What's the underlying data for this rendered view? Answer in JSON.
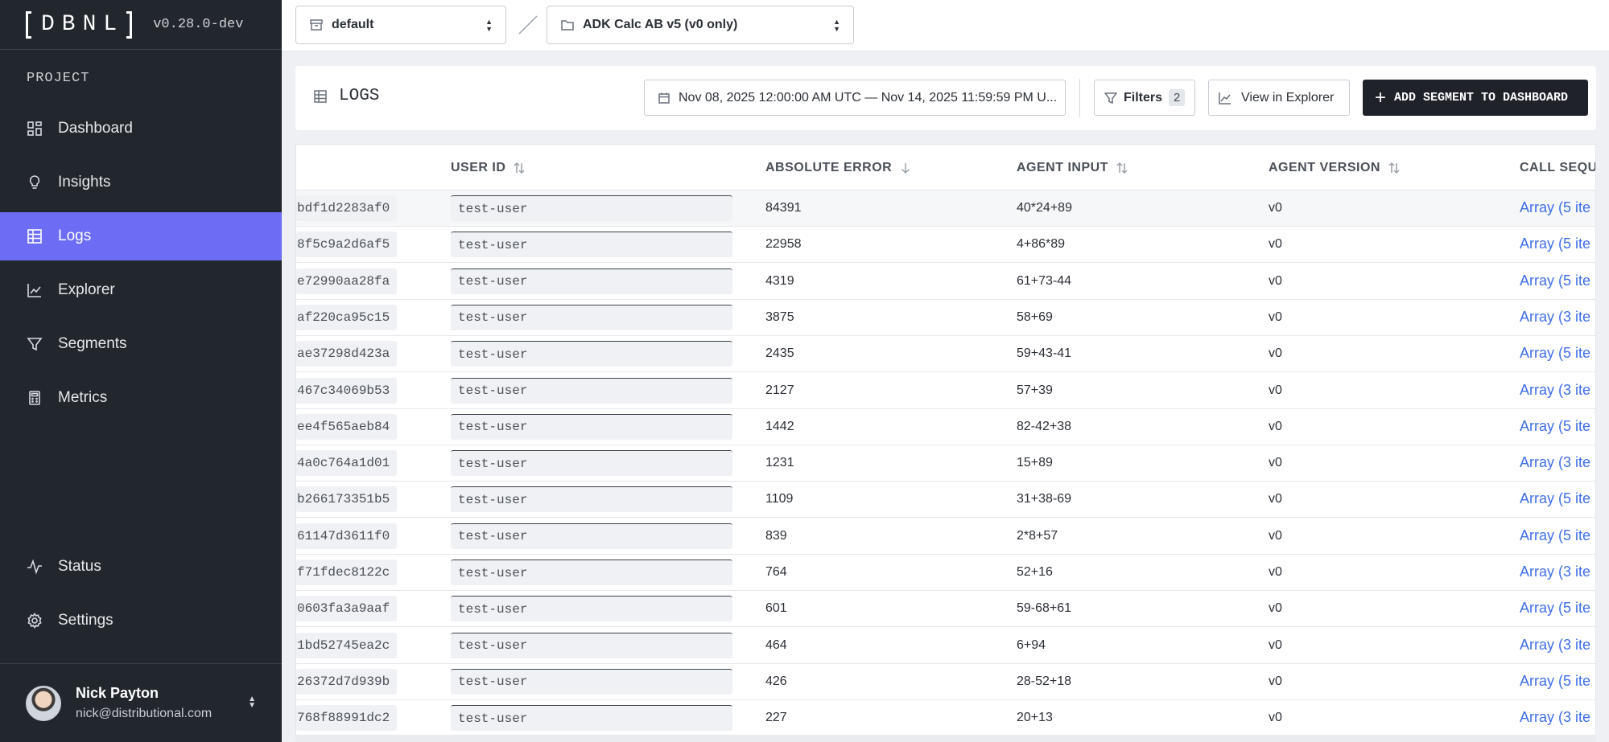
{
  "sidebar": {
    "logo_text": "DBNL",
    "version": "v0.28.0-dev",
    "section_title": "PROJECT",
    "items": [
      {
        "label": "Dashboard",
        "icon": "dashboard-icon"
      },
      {
        "label": "Insights",
        "icon": "lightbulb-icon"
      },
      {
        "label": "Logs",
        "icon": "table-icon",
        "active": true
      },
      {
        "label": "Explorer",
        "icon": "line-chart-icon"
      },
      {
        "label": "Segments",
        "icon": "filter-icon"
      },
      {
        "label": "Metrics",
        "icon": "calculator-icon"
      }
    ],
    "bottom_items": [
      {
        "label": "Status",
        "icon": "pulse-icon"
      },
      {
        "label": "Settings",
        "icon": "gear-icon"
      }
    ],
    "user": {
      "name": "Nick Payton",
      "email": "nick@distributional.com"
    }
  },
  "topbar": {
    "namespace": "default",
    "project": "ADK Calc AB v5 (v0 only)"
  },
  "header": {
    "title": "LOGS",
    "date_range": "Nov 08, 2025 12:00:00 AM UTC — Nov 14, 2025 11:59:59 PM U...",
    "filters_label": "Filters",
    "filters_count": "2",
    "explorer_label": "View in Explorer",
    "add_segment_label": "ADD SEGMENT TO DASHBOARD"
  },
  "table": {
    "columns": [
      {
        "label": "USER ID",
        "sort": "both"
      },
      {
        "label": "ABSOLUTE ERROR",
        "sort": "desc"
      },
      {
        "label": "AGENT INPUT",
        "sort": "both"
      },
      {
        "label": "AGENT VERSION",
        "sort": "both"
      },
      {
        "label": "CALL SEQUE",
        "sort": "none"
      }
    ],
    "rows": [
      {
        "id": "bdf1d2283af0",
        "user": "test-user",
        "error": "84391",
        "input": "40*24+89",
        "version": "v0",
        "seq": "Array (5 ite"
      },
      {
        "id": "8f5c9a2d6af5",
        "user": "test-user",
        "error": "22958",
        "input": "4+86*89",
        "version": "v0",
        "seq": "Array (5 ite"
      },
      {
        "id": "e72990aa28fa",
        "user": "test-user",
        "error": "4319",
        "input": "61+73-44",
        "version": "v0",
        "seq": "Array (5 ite"
      },
      {
        "id": "af220ca95c15",
        "user": "test-user",
        "error": "3875",
        "input": "58+69",
        "version": "v0",
        "seq": "Array (3 ite"
      },
      {
        "id": "ae37298d423a",
        "user": "test-user",
        "error": "2435",
        "input": "59+43-41",
        "version": "v0",
        "seq": "Array (5 ite"
      },
      {
        "id": "467c34069b53",
        "user": "test-user",
        "error": "2127",
        "input": "57+39",
        "version": "v0",
        "seq": "Array (3 ite"
      },
      {
        "id": "ee4f565aeb84",
        "user": "test-user",
        "error": "1442",
        "input": "82-42+38",
        "version": "v0",
        "seq": "Array (5 ite"
      },
      {
        "id": "4a0c764a1d01",
        "user": "test-user",
        "error": "1231",
        "input": "15+89",
        "version": "v0",
        "seq": "Array (3 ite"
      },
      {
        "id": "b266173351b5",
        "user": "test-user",
        "error": "1109",
        "input": "31+38-69",
        "version": "v0",
        "seq": "Array (5 ite"
      },
      {
        "id": "61147d3611f0",
        "user": "test-user",
        "error": "839",
        "input": "2*8+57",
        "version": "v0",
        "seq": "Array (5 ite"
      },
      {
        "id": "f71fdec8122c",
        "user": "test-user",
        "error": "764",
        "input": "52+16",
        "version": "v0",
        "seq": "Array (3 ite"
      },
      {
        "id": "0603fa3a9aaf",
        "user": "test-user",
        "error": "601",
        "input": "59-68+61",
        "version": "v0",
        "seq": "Array (5 ite"
      },
      {
        "id": "1bd52745ea2c",
        "user": "test-user",
        "error": "464",
        "input": "6+94",
        "version": "v0",
        "seq": "Array (3 ite"
      },
      {
        "id": "26372d7d939b",
        "user": "test-user",
        "error": "426",
        "input": "28-52+18",
        "version": "v0",
        "seq": "Array (5 ite"
      },
      {
        "id": "768f88991dc2",
        "user": "test-user",
        "error": "227",
        "input": "20+13",
        "version": "v0",
        "seq": "Array (3 ite"
      }
    ]
  },
  "colors": {
    "sidebar_bg": "#22262d",
    "active_nav": "#6c6cf5",
    "link": "#3f6ee8",
    "primary_button": "#1f2329"
  }
}
